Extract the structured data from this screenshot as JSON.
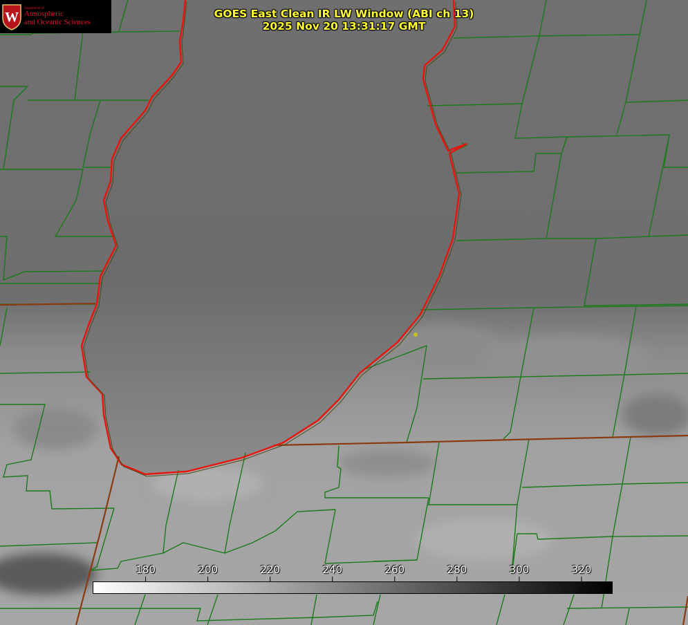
{
  "logo": {
    "dept_line": "Department of",
    "line1": "Atmospheric",
    "line2": "and Oceanic Sciences",
    "seal_letter": "W",
    "icon": "uw-crest-icon"
  },
  "title": {
    "line1": "GOES East Clean IR LW Window (ABI ch 13)",
    "line2": "2025 Nov 20 13:31:17 GMT"
  },
  "colorbar": {
    "ticks": [
      "180",
      "200",
      "220",
      "240",
      "260",
      "280",
      "300",
      "320"
    ],
    "min": 163,
    "max": 330,
    "color_low": "#ffffff",
    "color_high": "#000000"
  },
  "colors": {
    "county_lines": "#1a7a1a",
    "coastline": "#e8140e",
    "title_text": "#ffff33",
    "marker": "#c8c21e"
  }
}
